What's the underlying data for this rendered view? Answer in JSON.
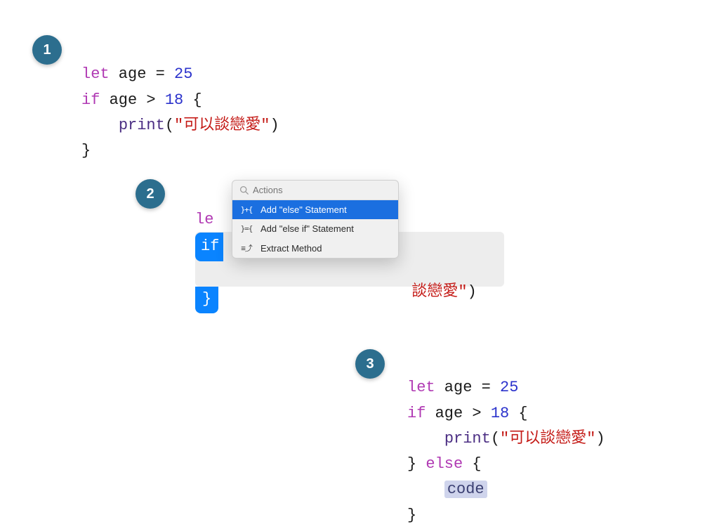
{
  "badges": {
    "one": "1",
    "two": "2",
    "three": "3"
  },
  "block1": {
    "l1a": "let",
    "l1b": " age = ",
    "l1c": "25",
    "l2a": "if",
    "l2b": " age > ",
    "l2c": "18",
    "l2d": " {",
    "l3a": "    ",
    "l3b": "print",
    "l3c": "(",
    "l3d": "\"可以談戀愛\"",
    "l3e": ")",
    "l4": "}"
  },
  "block2": {
    "let_frag": "le",
    "if_frag": "if",
    "print_tail_a": "談戀愛\"",
    "print_tail_b": ")",
    "brace": "}"
  },
  "popup": {
    "search_placeholder": "Actions",
    "items": [
      {
        "icon": "}+{",
        "label": "Add \"else\" Statement"
      },
      {
        "icon": "}={",
        "label": "Add \"else if\" Statement"
      },
      {
        "icon": "≡⤴",
        "label": "Extract Method"
      }
    ]
  },
  "block3": {
    "l1a": "let",
    "l1b": " age = ",
    "l1c": "25",
    "l2a": "if",
    "l2b": " age > ",
    "l2c": "18",
    "l2d": " {",
    "l3a": "    ",
    "l3b": "print",
    "l3c": "(",
    "l3d": "\"可以談戀愛\"",
    "l3e": ")",
    "l4a": "} ",
    "l4b": "else",
    "l4c": " {",
    "l5a": "    ",
    "l5b": "code",
    "l6": "}"
  }
}
